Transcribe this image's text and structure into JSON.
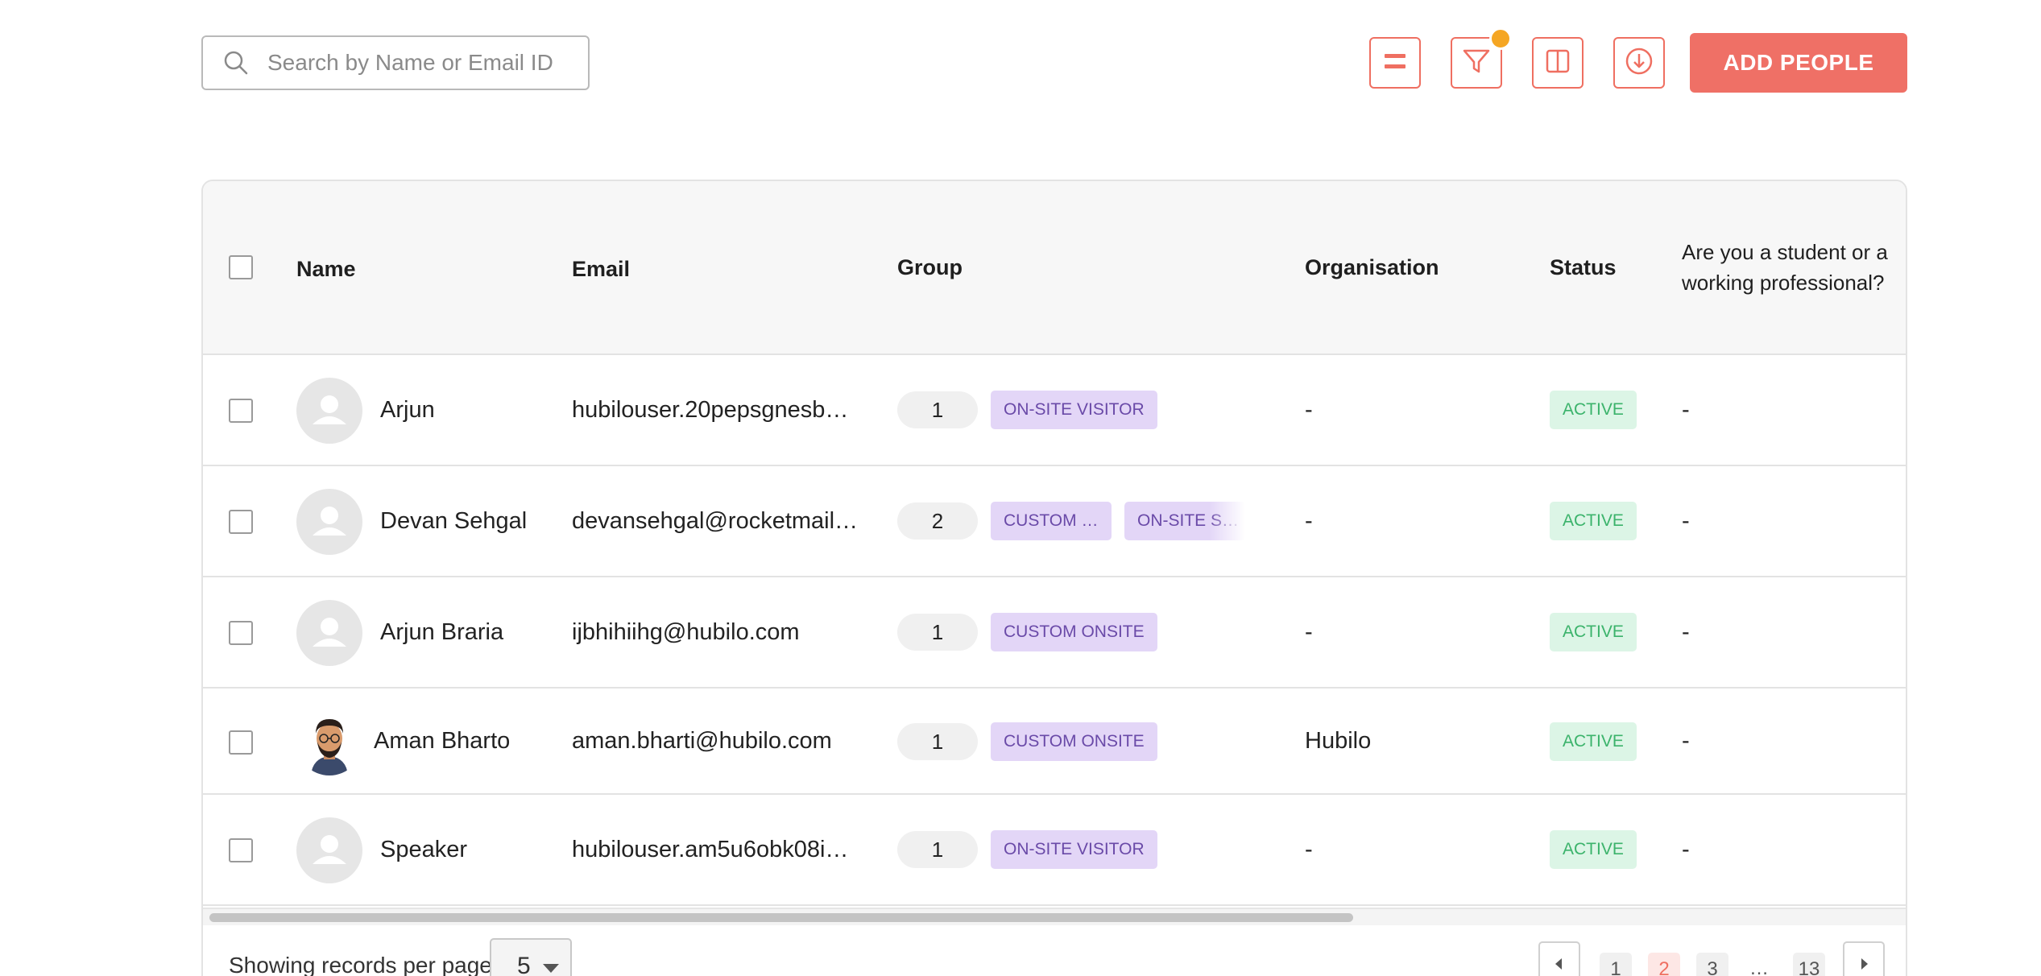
{
  "toolbar": {
    "search_placeholder": "Search by Name or Email ID",
    "search_value": "",
    "buttons": [
      {
        "name": "list-view-icon"
      },
      {
        "name": "filter-icon",
        "has_indicator": true
      },
      {
        "name": "columns-icon"
      },
      {
        "name": "download-icon"
      }
    ],
    "add_label": "ADD PEOPLE"
  },
  "table": {
    "headers": {
      "name": "Name",
      "email": "Email",
      "group": "Group",
      "organisation": "Organisation",
      "status": "Status",
      "question_line1": "Are you a student or a",
      "question_line2": "working professional?"
    },
    "rows": [
      {
        "name": "Arjun",
        "email": "hubilouser.20pepsgnesb…",
        "group_count": "1",
        "tags": [
          "ON-SITE VISITOR"
        ],
        "organisation": "-",
        "status": "ACTIVE",
        "answer": "-",
        "avatar": "placeholder"
      },
      {
        "name": "Devan Sehgal",
        "email": "devansehgal@rocketmail…",
        "group_count": "2",
        "tags": [
          "CUSTOM …",
          "ON-SITE S…"
        ],
        "organisation": "-",
        "status": "ACTIVE",
        "answer": "-",
        "avatar": "placeholder"
      },
      {
        "name": "Arjun Braria",
        "email": "ijbhihiihg@hubilo.com",
        "group_count": "1",
        "tags": [
          "CUSTOM ONSITE"
        ],
        "organisation": "-",
        "status": "ACTIVE",
        "answer": "-",
        "avatar": "placeholder"
      },
      {
        "name": "Aman Bharto",
        "email": "aman.bharti@hubilo.com",
        "group_count": "1",
        "tags": [
          "CUSTOM ONSITE"
        ],
        "organisation": "Hubilo",
        "status": "ACTIVE",
        "answer": "-",
        "avatar": "photo"
      },
      {
        "name": "Speaker",
        "email": "hubilouser.am5u6obk08i…",
        "group_count": "1",
        "tags": [
          "ON-SITE VISITOR"
        ],
        "organisation": "-",
        "status": "ACTIVE",
        "answer": "-",
        "avatar": "placeholder"
      }
    ]
  },
  "footer": {
    "per_page_label": "Showing records per page",
    "per_page_value": "5",
    "pages": [
      "1",
      "2",
      "3",
      "…",
      "13"
    ],
    "current_page": "2"
  },
  "colors": {
    "accent": "#ef6f61",
    "indicator": "#f5a623",
    "tag_bg": "#e3d6f7",
    "tag_text": "#6a4aa8",
    "status_bg": "#dcf5e6",
    "status_text": "#3bb36b"
  }
}
